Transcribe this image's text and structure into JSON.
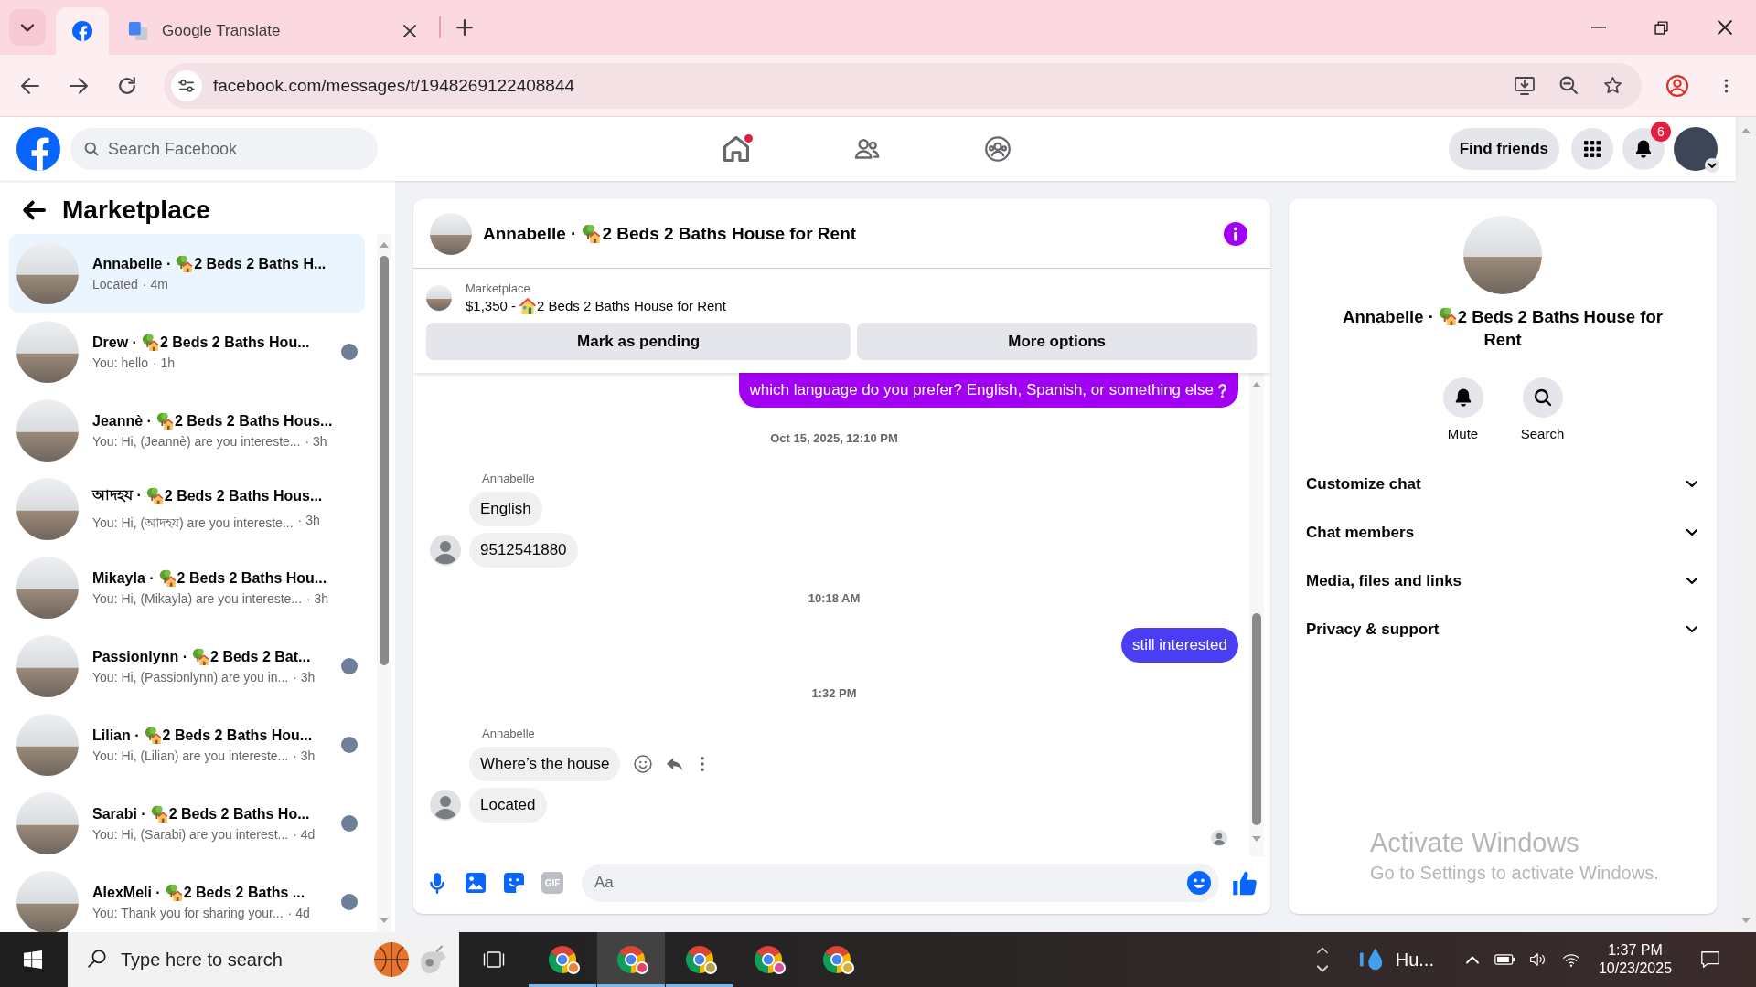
{
  "browser": {
    "tabs": [
      {
        "kind": "facebook",
        "selected": true
      },
      {
        "kind": "translate",
        "title": "Google Translate",
        "selected": false
      }
    ],
    "url": "facebook.com/messages/t/1948269122408844"
  },
  "header": {
    "search": {
      "placeholder": "Search Facebook"
    },
    "nav": [
      {
        "kind": "home",
        "selected": false,
        "dot": true
      },
      {
        "kind": "friends",
        "selected": false,
        "dot": false
      },
      {
        "kind": "groups",
        "selected": false,
        "dot": false
      }
    ],
    "find_friends": "Find friends",
    "notifications": {
      "badge": "6"
    }
  },
  "sidebar": {
    "title": "Marketplace",
    "conversations": [
      {
        "name": "Annabelle ·",
        "listing": "2 Beds 2 Baths H...",
        "preview": "Located",
        "time": "· 4m",
        "selected": true,
        "seen": false
      },
      {
        "name": "Drew ·",
        "listing": "2 Beds 2 Baths Hou...",
        "preview": "You: hello",
        "time": "· 1h",
        "selected": false,
        "seen": true
      },
      {
        "name": "Jeannè ·",
        "listing": "2 Beds 2 Baths Hous...",
        "preview": "You: Hi, (Jeannè) are you intereste...",
        "time": "· 3h",
        "selected": false,
        "seen": false
      },
      {
        "name": "আদহয ·",
        "listing": "2 Beds 2 Baths Hous...",
        "preview": "You: Hi, (আদহয) are you intereste...",
        "time": "· 3h",
        "selected": false,
        "seen": false
      },
      {
        "name": "Mikayla ·",
        "listing": "2 Beds 2 Baths Hou...",
        "preview": "You: Hi, (Mikayla) are you intereste...",
        "time": "· 3h",
        "selected": false,
        "seen": false
      },
      {
        "name": "Passionlynn ·",
        "listing": "2 Beds 2 Bat...",
        "preview": "You: Hi, (Passionlynn) are you in...",
        "time": "· 3h",
        "selected": false,
        "seen": true
      },
      {
        "name": "Lilian ·",
        "listing": "2 Beds 2 Baths Hou...",
        "preview": "You: Hi, (Lilian) are you intereste...",
        "time": "· 3h",
        "selected": false,
        "seen": true
      },
      {
        "name": "Sarabi ·",
        "listing": "2 Beds 2 Baths Ho...",
        "preview": "You: Hi, (Sarabi) are you interest...",
        "time": "· 4d",
        "selected": false,
        "seen": true
      },
      {
        "name": "AlexMeli ·",
        "listing": "2 Beds 2 Baths ...",
        "preview": "You: Thank you for sharing your...",
        "time": "· 4d",
        "selected": false,
        "seen": true
      }
    ]
  },
  "chat": {
    "name": "Annabelle ·",
    "listing": "2 Beds 2 Baths House for Rent",
    "item": {
      "label": "Marketplace",
      "price": "$1,350 -",
      "title": "2 Beds 2 Baths House for Rent"
    },
    "actions": [
      {
        "label": "Mark as pending"
      },
      {
        "label": "More options"
      }
    ],
    "messages": [
      {
        "kind": "outgoing",
        "text": "which language do you prefer? English, Spanish, or something else",
        "color": "#a100f2",
        "question_emoji": true
      },
      {
        "kind": "timestamp",
        "text": "Oct 15, 2025, 12:10 PM"
      },
      {
        "kind": "sender",
        "text": "Annabelle"
      },
      {
        "kind": "incoming",
        "text": "English",
        "avatar": false,
        "actions": false
      },
      {
        "kind": "incoming",
        "text": "9512541880",
        "avatar": true,
        "actions": false
      },
      {
        "kind": "timestamp",
        "text": "10:18 AM"
      },
      {
        "kind": "outgoing",
        "text": "still interested",
        "color": "#4a3ef5",
        "question_emoji": false
      },
      {
        "kind": "timestamp",
        "text": "1:32 PM"
      },
      {
        "kind": "sender",
        "text": "Annabelle"
      },
      {
        "kind": "incoming",
        "text": "Where’s the house",
        "avatar": false,
        "actions": true
      },
      {
        "kind": "incoming",
        "text": "Located",
        "avatar": true,
        "actions": false
      }
    ],
    "seen": true,
    "composer": {
      "gif": "GIF",
      "placeholder": "Aa"
    }
  },
  "details": {
    "name": "Annabelle ·",
    "listing": "2 Beds 2 Baths House for Rent",
    "buttons": [
      {
        "kind": "mute",
        "label": "Mute"
      },
      {
        "kind": "search",
        "label": "Search"
      }
    ],
    "sections": [
      {
        "label": "Customize chat",
        "expanded": false
      },
      {
        "label": "Chat members",
        "expanded": false
      },
      {
        "label": "Media, files and links",
        "expanded": false
      },
      {
        "label": "Privacy & support",
        "expanded": false
      }
    ]
  },
  "activation_notice": {
    "title": "Activate Windows",
    "subtitle": "Go to Settings to activate Windows."
  },
  "taskbar": {
    "search": {
      "placeholder": "Type here to search"
    },
    "apps": [
      {
        "kind": "chrome",
        "color": "#e8853a",
        "running": true,
        "selected": false
      },
      {
        "kind": "chrome",
        "color": "#e0456a",
        "running": true,
        "selected": true
      },
      {
        "kind": "chrome",
        "color": "#b5a24a",
        "running": true,
        "selected": false
      },
      {
        "kind": "chrome",
        "color": "#d84fa0",
        "running": false,
        "selected": false
      },
      {
        "kind": "chrome",
        "color": "#d8b040",
        "running": false,
        "selected": false
      }
    ],
    "weather": "Hu...",
    "time": "1:37 PM",
    "date": "10/23/2025"
  }
}
